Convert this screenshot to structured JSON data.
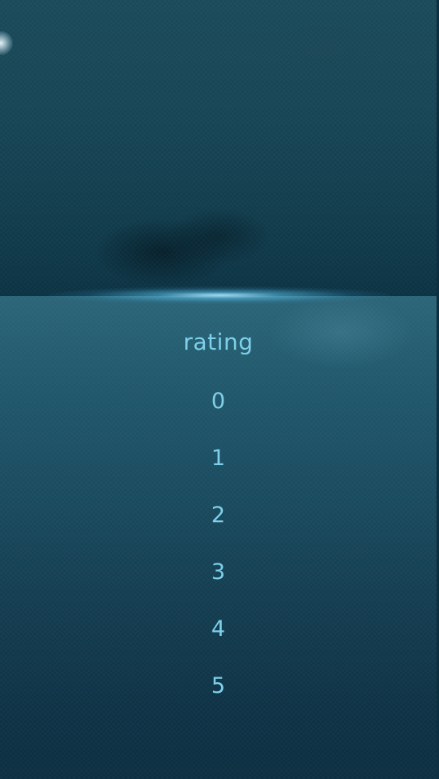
{
  "picker": {
    "title": "rating",
    "options": [
      "0",
      "1",
      "2",
      "3",
      "4",
      "5"
    ]
  },
  "colors": {
    "accent_text": "#7ed0ea",
    "glow": "#aae6ff",
    "panel_top": "#2c6578",
    "panel_bottom": "#0d2f42",
    "backdrop": "#174556"
  }
}
